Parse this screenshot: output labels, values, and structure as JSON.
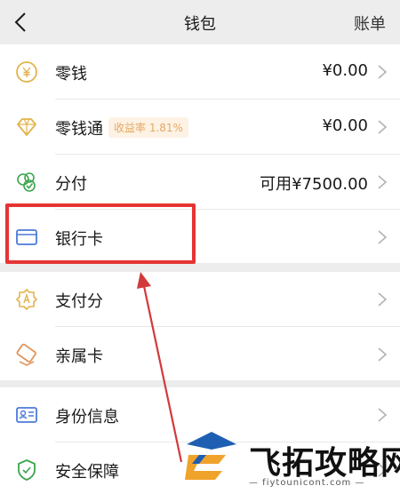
{
  "nav": {
    "title": "钱包",
    "bill_label": "账单"
  },
  "section1": [
    {
      "label": "零钱",
      "value": "¥0.00"
    },
    {
      "label": "零钱通",
      "badge": "收益率 1.81%",
      "value": "¥0.00"
    },
    {
      "label": "分付",
      "value": "可用¥7500.00"
    },
    {
      "label": "银行卡",
      "value": ""
    }
  ],
  "section2": [
    {
      "label": "支付分"
    },
    {
      "label": "亲属卡"
    }
  ],
  "section3": [
    {
      "label": "身份信息"
    },
    {
      "label": "安全保障"
    }
  ],
  "watermark": {
    "title": "飞拓攻略网",
    "url": "— fiytounicont.com —"
  },
  "colors": {
    "icon_gold": "#e3b34c",
    "icon_green": "#3aa64f",
    "icon_blue": "#4b7ad8",
    "highlight": "#e53434"
  }
}
